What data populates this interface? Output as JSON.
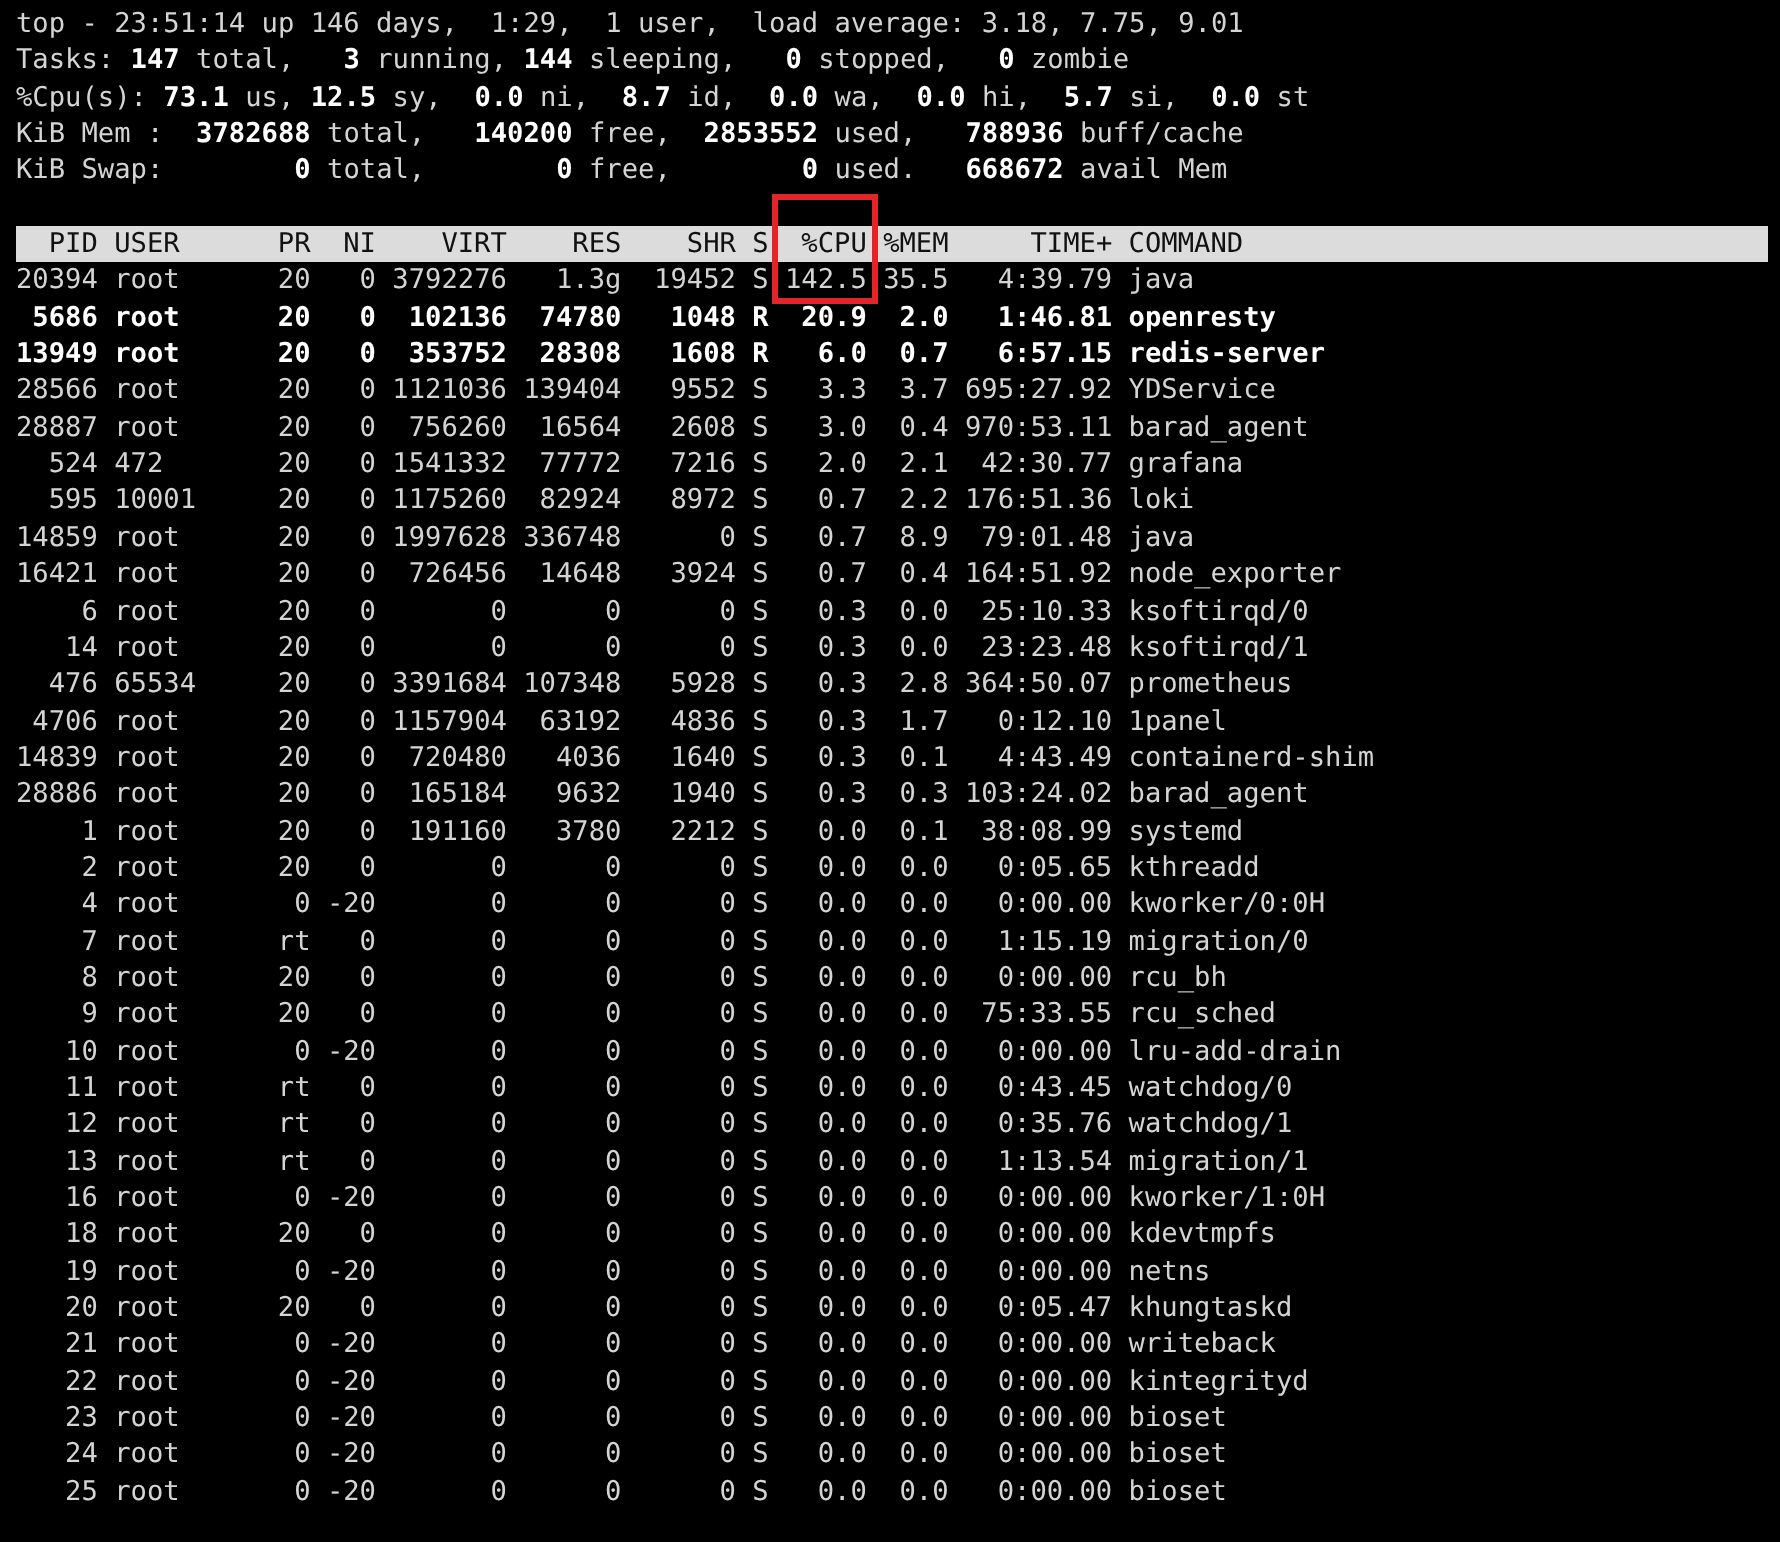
{
  "summary": [
    "top - 23:51:14 up 146 days,  1:29,  1 user,  load average: 3.18, 7.75, 9.01",
    "Tasks: **147** total,   **3** running, **144** sleeping,   **0** stopped,   **0** zombie",
    "%Cpu(s): **73.1** us, **12.5** sy,  **0.0** ni,  **8.7** id,  **0.0** wa,  **0.0** hi,  **5.7** si,  **0.0** st",
    "KiB Mem :  **3782688** total,   **140200** free,  **2853552** used,   **788936** buff/cache",
    "KiB Swap:        **0** total,        **0** free,        **0** used.   **668672** avail Mem"
  ],
  "table": {
    "columns": [
      {
        "label": "PID"
      },
      {
        "label": "USER"
      },
      {
        "label": "PR"
      },
      {
        "label": "NI"
      },
      {
        "label": "VIRT"
      },
      {
        "label": "RES"
      },
      {
        "label": "SHR"
      },
      {
        "label": "S"
      },
      {
        "label": "%CPU",
        "highlighted": true
      },
      {
        "label": "%MEM"
      },
      {
        "label": "TIME+"
      },
      {
        "label": "COMMAND"
      }
    ],
    "rows": [
      {
        "bold": false,
        "highlighted": true,
        "cells": [
          "20394",
          "root",
          "20",
          "0",
          "3792276",
          "1.3g",
          "19452",
          "S",
          "142.5",
          "35.5",
          "4:39.79",
          "java"
        ]
      },
      {
        "bold": true,
        "cells": [
          "5686",
          "root",
          "20",
          "0",
          "102136",
          "74780",
          "1048",
          "R",
          "20.9",
          "2.0",
          "1:46.81",
          "openresty"
        ]
      },
      {
        "bold": true,
        "cells": [
          "13949",
          "root",
          "20",
          "0",
          "353752",
          "28308",
          "1608",
          "R",
          "6.0",
          "0.7",
          "6:57.15",
          "redis-server"
        ]
      },
      {
        "bold": false,
        "cells": [
          "28566",
          "root",
          "20",
          "0",
          "1121036",
          "139404",
          "9552",
          "S",
          "3.3",
          "3.7",
          "695:27.92",
          "YDService"
        ]
      },
      {
        "bold": false,
        "cells": [
          "28887",
          "root",
          "20",
          "0",
          "756260",
          "16564",
          "2608",
          "S",
          "3.0",
          "0.4",
          "970:53.11",
          "barad_agent"
        ]
      },
      {
        "bold": false,
        "cells": [
          "524",
          "472",
          "20",
          "0",
          "1541332",
          "77772",
          "7216",
          "S",
          "2.0",
          "2.1",
          "42:30.77",
          "grafana"
        ]
      },
      {
        "bold": false,
        "cells": [
          "595",
          "10001",
          "20",
          "0",
          "1175260",
          "82924",
          "8972",
          "S",
          "0.7",
          "2.2",
          "176:51.36",
          "loki"
        ]
      },
      {
        "bold": false,
        "cells": [
          "14859",
          "root",
          "20",
          "0",
          "1997628",
          "336748",
          "0",
          "S",
          "0.7",
          "8.9",
          "79:01.48",
          "java"
        ]
      },
      {
        "bold": false,
        "cells": [
          "16421",
          "root",
          "20",
          "0",
          "726456",
          "14648",
          "3924",
          "S",
          "0.7",
          "0.4",
          "164:51.92",
          "node_exporter"
        ]
      },
      {
        "bold": false,
        "cells": [
          "6",
          "root",
          "20",
          "0",
          "0",
          "0",
          "0",
          "S",
          "0.3",
          "0.0",
          "25:10.33",
          "ksoftirqd/0"
        ]
      },
      {
        "bold": false,
        "cells": [
          "14",
          "root",
          "20",
          "0",
          "0",
          "0",
          "0",
          "S",
          "0.3",
          "0.0",
          "23:23.48",
          "ksoftirqd/1"
        ]
      },
      {
        "bold": false,
        "cells": [
          "476",
          "65534",
          "20",
          "0",
          "3391684",
          "107348",
          "5928",
          "S",
          "0.3",
          "2.8",
          "364:50.07",
          "prometheus"
        ]
      },
      {
        "bold": false,
        "cells": [
          "4706",
          "root",
          "20",
          "0",
          "1157904",
          "63192",
          "4836",
          "S",
          "0.3",
          "1.7",
          "0:12.10",
          "1panel"
        ]
      },
      {
        "bold": false,
        "cells": [
          "14839",
          "root",
          "20",
          "0",
          "720480",
          "4036",
          "1640",
          "S",
          "0.3",
          "0.1",
          "4:43.49",
          "containerd-shim"
        ]
      },
      {
        "bold": false,
        "cells": [
          "28886",
          "root",
          "20",
          "0",
          "165184",
          "9632",
          "1940",
          "S",
          "0.3",
          "0.3",
          "103:24.02",
          "barad_agent"
        ]
      },
      {
        "bold": false,
        "cells": [
          "1",
          "root",
          "20",
          "0",
          "191160",
          "3780",
          "2212",
          "S",
          "0.0",
          "0.1",
          "38:08.99",
          "systemd"
        ]
      },
      {
        "bold": false,
        "cells": [
          "2",
          "root",
          "20",
          "0",
          "0",
          "0",
          "0",
          "S",
          "0.0",
          "0.0",
          "0:05.65",
          "kthreadd"
        ]
      },
      {
        "bold": false,
        "cells": [
          "4",
          "root",
          "0",
          "-20",
          "0",
          "0",
          "0",
          "S",
          "0.0",
          "0.0",
          "0:00.00",
          "kworker/0:0H"
        ]
      },
      {
        "bold": false,
        "cells": [
          "7",
          "root",
          "rt",
          "0",
          "0",
          "0",
          "0",
          "S",
          "0.0",
          "0.0",
          "1:15.19",
          "migration/0"
        ]
      },
      {
        "bold": false,
        "cells": [
          "8",
          "root",
          "20",
          "0",
          "0",
          "0",
          "0",
          "S",
          "0.0",
          "0.0",
          "0:00.00",
          "rcu_bh"
        ]
      },
      {
        "bold": false,
        "cells": [
          "9",
          "root",
          "20",
          "0",
          "0",
          "0",
          "0",
          "S",
          "0.0",
          "0.0",
          "75:33.55",
          "rcu_sched"
        ]
      },
      {
        "bold": false,
        "cells": [
          "10",
          "root",
          "0",
          "-20",
          "0",
          "0",
          "0",
          "S",
          "0.0",
          "0.0",
          "0:00.00",
          "lru-add-drain"
        ]
      },
      {
        "bold": false,
        "cells": [
          "11",
          "root",
          "rt",
          "0",
          "0",
          "0",
          "0",
          "S",
          "0.0",
          "0.0",
          "0:43.45",
          "watchdog/0"
        ]
      },
      {
        "bold": false,
        "cells": [
          "12",
          "root",
          "rt",
          "0",
          "0",
          "0",
          "0",
          "S",
          "0.0",
          "0.0",
          "0:35.76",
          "watchdog/1"
        ]
      },
      {
        "bold": false,
        "cells": [
          "13",
          "root",
          "rt",
          "0",
          "0",
          "0",
          "0",
          "S",
          "0.0",
          "0.0",
          "1:13.54",
          "migration/1"
        ]
      },
      {
        "bold": false,
        "cells": [
          "16",
          "root",
          "0",
          "-20",
          "0",
          "0",
          "0",
          "S",
          "0.0",
          "0.0",
          "0:00.00",
          "kworker/1:0H"
        ]
      },
      {
        "bold": false,
        "cells": [
          "18",
          "root",
          "20",
          "0",
          "0",
          "0",
          "0",
          "S",
          "0.0",
          "0.0",
          "0:00.00",
          "kdevtmpfs"
        ]
      },
      {
        "bold": false,
        "cells": [
          "19",
          "root",
          "0",
          "-20",
          "0",
          "0",
          "0",
          "S",
          "0.0",
          "0.0",
          "0:00.00",
          "netns"
        ]
      },
      {
        "bold": false,
        "cells": [
          "20",
          "root",
          "20",
          "0",
          "0",
          "0",
          "0",
          "S",
          "0.0",
          "0.0",
          "0:05.47",
          "khungtaskd"
        ]
      },
      {
        "bold": false,
        "cells": [
          "21",
          "root",
          "0",
          "-20",
          "0",
          "0",
          "0",
          "S",
          "0.0",
          "0.0",
          "0:00.00",
          "writeback"
        ]
      },
      {
        "bold": false,
        "cells": [
          "22",
          "root",
          "0",
          "-20",
          "0",
          "0",
          "0",
          "S",
          "0.0",
          "0.0",
          "0:00.00",
          "kintegrityd"
        ]
      },
      {
        "bold": false,
        "cells": [
          "23",
          "root",
          "0",
          "-20",
          "0",
          "0",
          "0",
          "S",
          "0.0",
          "0.0",
          "0:00.00",
          "bioset"
        ]
      },
      {
        "bold": false,
        "cells": [
          "24",
          "root",
          "0",
          "-20",
          "0",
          "0",
          "0",
          "S",
          "0.0",
          "0.0",
          "0:00.00",
          "bioset"
        ]
      },
      {
        "bold": false,
        "cells": [
          "25",
          "root",
          "0",
          "-20",
          "0",
          "0",
          "0",
          "S",
          "0.0",
          "0.0",
          "0:00.00",
          "bioset"
        ]
      }
    ]
  }
}
